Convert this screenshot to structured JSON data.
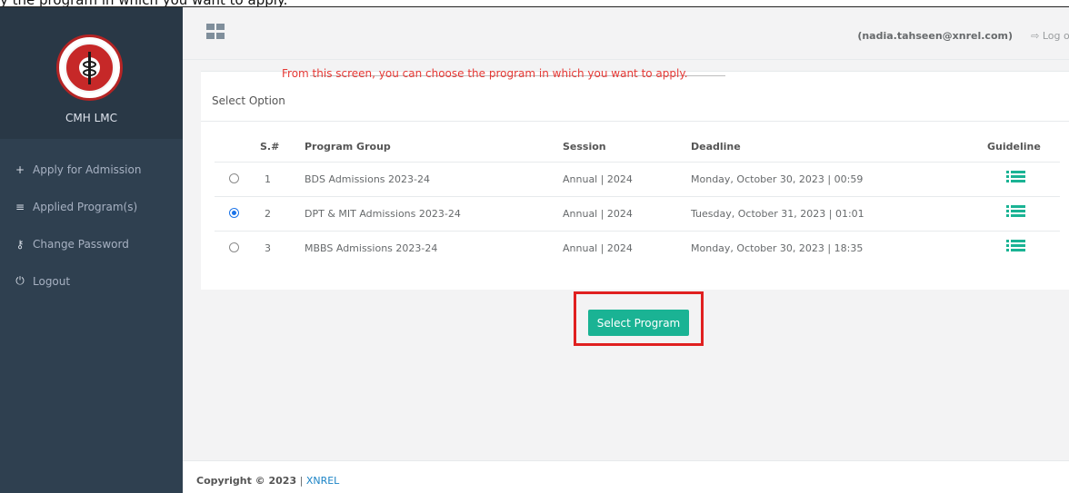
{
  "caption": "y the program in which you want to apply.",
  "brand": {
    "name": "CMH LMC"
  },
  "sidebar": {
    "items": [
      {
        "icon": "plus-icon",
        "glyph": "+",
        "label": "Apply for Admission"
      },
      {
        "icon": "list-icon",
        "glyph": "≡",
        "label": "Applied Program(s)"
      },
      {
        "icon": "key-icon",
        "glyph": "⚷",
        "label": "Change Password"
      },
      {
        "icon": "power-icon",
        "glyph": "⏻",
        "label": "Logout"
      }
    ]
  },
  "header": {
    "user_email": "(nadia.tahseen@xnrel.com)",
    "logout_glyph": "⇨",
    "logout_label": "Log out"
  },
  "instruction": "From this screen, you can choose the program in which you want to apply.",
  "panel": {
    "title": "Select Option",
    "columns": {
      "sno": "S.#",
      "program": "Program Group",
      "session": "Session",
      "deadline": "Deadline",
      "guideline": "Guideline"
    },
    "rows": [
      {
        "selected": false,
        "sno": "1",
        "program": "BDS Admissions 2023-24",
        "session": "Annual | 2024",
        "deadline": "Monday, October 30, 2023 | 00:59"
      },
      {
        "selected": true,
        "sno": "2",
        "program": "DPT & MIT Admissions 2023-24",
        "session": "Annual | 2024",
        "deadline": "Tuesday, October 31, 2023 | 01:01"
      },
      {
        "selected": false,
        "sno": "3",
        "program": "MBBS Admissions 2023-24",
        "session": "Annual | 2024",
        "deadline": "Monday, October 30, 2023 | 18:35"
      }
    ]
  },
  "action": {
    "select_label": "Select Program"
  },
  "footer": {
    "copyright": "Copyright © 2023",
    "separator": " | ",
    "company": "XNREL"
  },
  "colors": {
    "sidebar": "#2f4050",
    "accent": "#1ab394",
    "instruction": "#e53935",
    "highlight": "#e02020"
  }
}
